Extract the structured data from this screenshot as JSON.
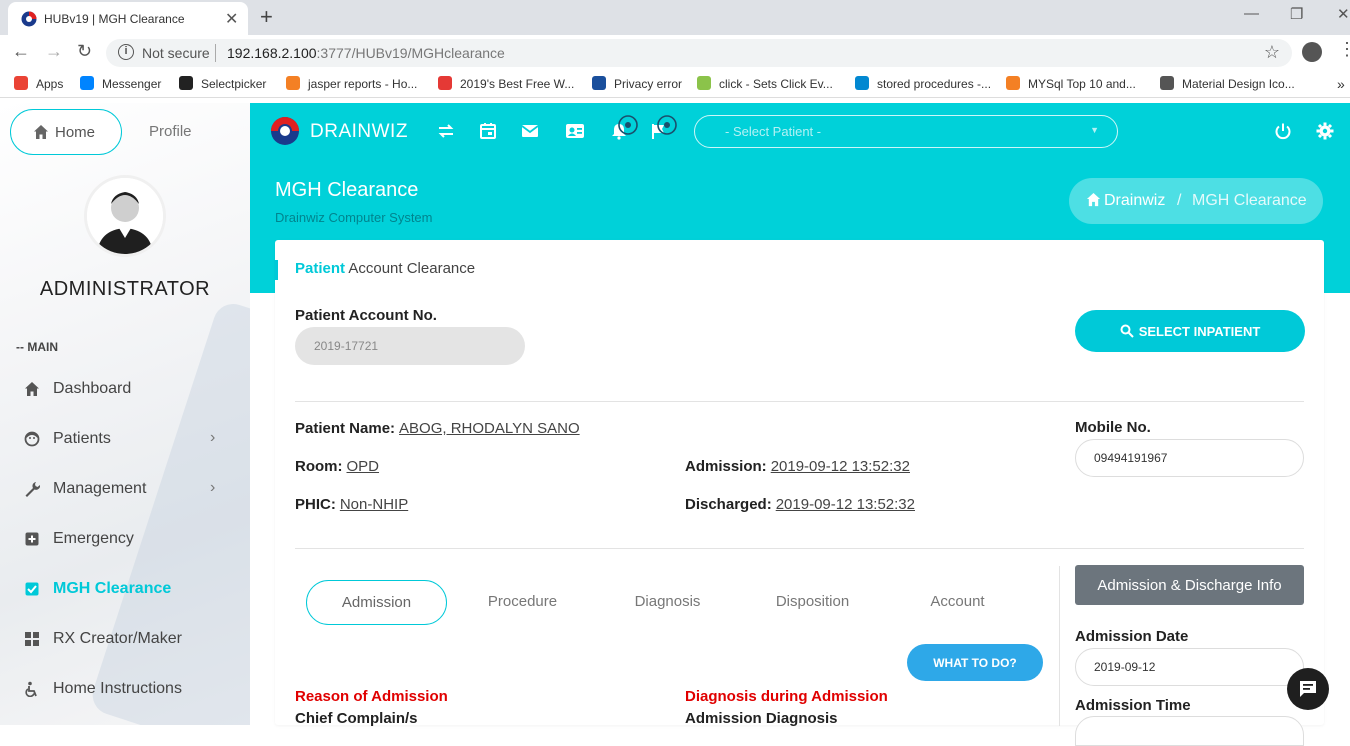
{
  "browser": {
    "tab_title": "HUBv19 | MGH Clearance",
    "tab_close": "✕",
    "new_tab": "+",
    "not_secure": "Not secure",
    "url_host": "192.168.2.100",
    "url_rest": ":3777/HUBv19/MGHclearance",
    "bookmarks": [
      {
        "label": "Apps",
        "color": "#ea4335"
      },
      {
        "label": "Messenger",
        "color": "#0084ff"
      },
      {
        "label": "Selectpicker",
        "color": "#222222"
      },
      {
        "label": "jasper reports - Ho...",
        "color": "#f48024"
      },
      {
        "label": "2019's Best Free W...",
        "color": "#e53935"
      },
      {
        "label": "Privacy error",
        "color": "#1a4f9c"
      },
      {
        "label": "click - Sets Click Ev...",
        "color": "#8bc34a"
      },
      {
        "label": "stored procedures -...",
        "color": "#0288d1"
      },
      {
        "label": "MYSql Top 10 and...",
        "color": "#f48024"
      },
      {
        "label": "Material Design Ico...",
        "color": "#555555"
      }
    ]
  },
  "sidebar": {
    "home_label": "Home",
    "profile_label": "Profile",
    "user_name": "ADMINISTRATOR",
    "section_label": "-- MAIN",
    "items": [
      {
        "label": "Dashboard",
        "icon": "home-icon",
        "chevron": ""
      },
      {
        "label": "Patients",
        "icon": "face-icon",
        "chevron": "›"
      },
      {
        "label": "Management",
        "icon": "wrench-icon",
        "chevron": "›"
      },
      {
        "label": "Emergency",
        "icon": "plus-box-icon",
        "chevron": ""
      },
      {
        "label": "MGH Clearance",
        "icon": "checkbox-icon",
        "chevron": ""
      },
      {
        "label": "RX Creator/Maker",
        "icon": "grid-icon",
        "chevron": ""
      },
      {
        "label": "Home Instructions",
        "icon": "wheelchair-icon",
        "chevron": ""
      }
    ]
  },
  "header": {
    "brand": "DRAINWIZ",
    "patient_placeholder": "- Select Patient -"
  },
  "banner": {
    "title": "MGH Clearance",
    "subtitle": "Drainwiz Computer System",
    "crumb_home": "Drainwiz",
    "crumb_sep": "/",
    "crumb_current": "MGH Clearance"
  },
  "card": {
    "title_highlight": "Patient",
    "title_rest": " Account Clearance",
    "account_label": "Patient Account No.",
    "account_value": "2019-17721",
    "select_button": "SELECT INPATIENT",
    "patient_name_label": "Patient Name:",
    "patient_name": "ABOG, RHODALYN SANO",
    "room_label": "Room:",
    "room": "OPD",
    "phic_label": "PHIC:",
    "phic": "Non-NHIP",
    "admission_label": "Admission:",
    "admission": "2019-09-12 13:52:32",
    "discharged_label": "Discharged:",
    "discharged": "2019-09-12 13:52:32",
    "mobile_label": "Mobile No.",
    "mobile": "09494191967",
    "tabs": [
      "Admission",
      "Procedure",
      "Diagnosis",
      "Disposition",
      "Account"
    ],
    "what_button": "WHAT TO DO?",
    "reason_heading": "Reason of Admission",
    "chief_label": "Chief Complain/s",
    "diag_heading": "Diagnosis during Admission",
    "adm_diag_label": "Admission Diagnosis",
    "info_button": "Admission & Discharge Info",
    "adm_date_label": "Admission Date",
    "adm_date": "2019-09-12",
    "adm_time_label": "Admission Time"
  },
  "colors": {
    "accent": "#00d1d9",
    "accent_dark": "#00c9d8",
    "danger": "#e00000",
    "info_btn": "#2ea8e8",
    "gray_btn": "#6c757d"
  }
}
